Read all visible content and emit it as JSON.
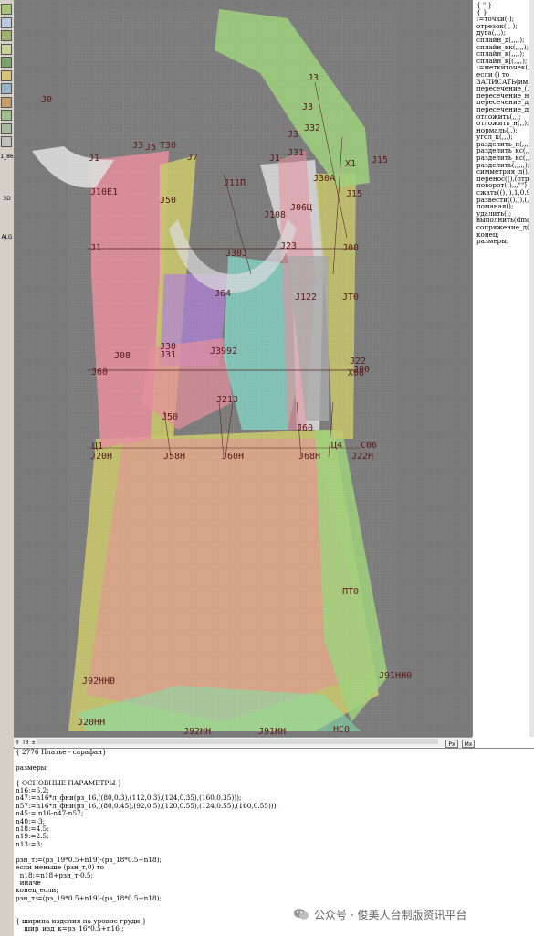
{
  "toolbar": {
    "tools": [
      {
        "icon": "pencil-icon",
        "color": "#a7c47a"
      },
      {
        "icon": "curve-icon",
        "color": "#b9c9e0"
      },
      {
        "icon": "grid-icon",
        "color": "#9fb26a"
      },
      {
        "icon": "line-icon",
        "color": "#c8d49a"
      },
      {
        "icon": "scissors-icon",
        "color": "#7aa36c"
      },
      {
        "icon": "measure-icon",
        "color": "#d9c27a"
      },
      {
        "icon": "mirror-icon",
        "color": "#9ab3c9"
      },
      {
        "icon": "magnet-icon",
        "color": "#c79b6b"
      },
      {
        "icon": "dart-icon",
        "color": "#9fbf8f"
      },
      {
        "icon": "rotate-icon",
        "color": "#a9b9a0"
      },
      {
        "icon": "text-g-icon",
        "color": "#c0c0c0"
      }
    ],
    "labels": {
      "l1": "1_86",
      "l2": "3D",
      "l3": "ALG"
    }
  },
  "canvas": {
    "background": "#7a7a7a",
    "grid": true,
    "point_labels": [
      {
        "text": "J0",
        "id": "j0"
      },
      {
        "text": "J3",
        "id": "j3"
      },
      {
        "text": "J10E1",
        "id": "j10e1"
      },
      {
        "text": "J5",
        "id": "j5"
      },
      {
        "text": "T30",
        "id": "t30"
      },
      {
        "text": "J7",
        "id": "j7"
      },
      {
        "text": "J11Π",
        "id": "j11p"
      },
      {
        "text": "J108",
        "id": "j108"
      },
      {
        "text": "J06Ц",
        "id": "j06c"
      },
      {
        "text": "J23",
        "id": "j23"
      },
      {
        "text": "J30J",
        "id": "j30j"
      },
      {
        "text": "J64",
        "id": "j64"
      },
      {
        "text": "J122",
        "id": "j122"
      },
      {
        "text": "JT0",
        "id": "jt0"
      },
      {
        "text": "J1",
        "id": "j1"
      },
      {
        "text": "J1",
        "id": "j1b"
      },
      {
        "text": "J1",
        "id": "j1c"
      },
      {
        "text": "J15",
        "id": "j15"
      },
      {
        "text": "J15",
        "id": "j15b"
      },
      {
        "text": "J3",
        "id": "j3b"
      },
      {
        "text": "J3",
        "id": "j3c"
      },
      {
        "text": "X1",
        "id": "x1"
      },
      {
        "text": "J30A",
        "id": "j30a"
      },
      {
        "text": "J00",
        "id": "j00"
      },
      {
        "text": "J31",
        "id": "j31"
      },
      {
        "text": "J50",
        "id": "j50"
      },
      {
        "text": "J3992",
        "id": "j3992"
      },
      {
        "text": "J30",
        "id": "j30"
      },
      {
        "text": "J08",
        "id": "j08"
      },
      {
        "text": "J60",
        "id": "j60"
      },
      {
        "text": "J00",
        "id": "j00b"
      },
      {
        "text": "J22",
        "id": "j22"
      },
      {
        "text": "X00",
        "id": "x00"
      },
      {
        "text": "J213",
        "id": "j213"
      },
      {
        "text": "J50",
        "id": "j50b"
      },
      {
        "text": "J60",
        "id": "j60b"
      },
      {
        "text": "Ц1",
        "id": "c1"
      },
      {
        "text": "J20H",
        "id": "j20h"
      },
      {
        "text": "J58H",
        "id": "j58h"
      },
      {
        "text": "J60H",
        "id": "j60h"
      },
      {
        "text": "J68H",
        "id": "j68h"
      },
      {
        "text": "Ц4",
        "id": "c4"
      },
      {
        "text": "C06",
        "id": "c06"
      },
      {
        "text": "J22H",
        "id": "j22h"
      },
      {
        "text": "ΠT0",
        "id": "pt0"
      },
      {
        "text": "J92HH0",
        "id": "j92hh0"
      },
      {
        "text": "J91HH0",
        "id": "j91hh0"
      },
      {
        "text": "J20HH",
        "id": "j20hh"
      },
      {
        "text": "J92HH",
        "id": "j92hh"
      },
      {
        "text": "J91HH",
        "id": "j91hh"
      },
      {
        "text": "HC0",
        "id": "hc0"
      },
      {
        "text": "J32",
        "id": "j32"
      },
      {
        "text": "J31",
        "id": "j31b"
      },
      {
        "text": "J3",
        "id": "j3d"
      }
    ],
    "colors": {
      "pink": "#e58d9b",
      "olive": "#c7c46a",
      "green": "#9ed07a",
      "cyan": "#84d8c8",
      "purple": "#b07fd8",
      "white": "#dcdcdc",
      "orange": "#e0a860",
      "mint": "#7fe0a8",
      "line": "#5a2a2a"
    }
  },
  "commands": {
    "items": [
      "{ \" }",
      "{ }",
      ":=точки(,);",
      "отрезок( , );",
      "дуга(,,,);",
      "сплайн_д(,,,,);",
      "сплайн_кк(,,,,);",
      "сплайн_к(,,,,);",
      "сплайн_к[(,,,,);",
      ":=меткиточек(,);",
      "если () то",
      "ЗАПИСАТЬ(имя",
      "пересечение_(,);",
      "пересечение_н(,",
      "пересечение_д(,",
      "пересечение_дн(",
      "отложить(,,);",
      "отложить_н(,,);",
      "нормаль(,,);",
      "угол_к(,,,);",
      "разделить_н(,,,,,",
      "разделить_кс(,,,,",
      "разделить_кс(,,,",
      "разделить(,,,,,);",
      "симметрия_л(),(",
      "перенос((),(отрез",
      "поворот((),,,\"\")",
      "сжать((),,),1,0.9,",
      "развести((),(),(,",
      "ломаная();",
      "удалить();",
      "выполнить(dmod",
      "сопряжение_д(,,",
      "конец;",
      "размеры;"
    ]
  },
  "status": {
    "coords": "0  T0 ± 0.0",
    "btn1": "Px",
    "btn2": "Mx"
  },
  "editor": {
    "lines": [
      "{ 2776 Платье - сарафан}",
      "",
      "размеры;",
      "",
      "{ ОСНОВНЫЕ ПАРАМЕТРЫ }",
      "n16:=6.2;",
      "n47:=n16*л_фни(рз_16,((80,0.3),(112,0.3),(124,0.35),(160,0.35)));",
      "n57:=n16*л_фни(рз_16,((80,0.45),(92,0.5),(120,0.55),(124,0.55),(160,0.55)));",
      "n45:= n16-n47-n57;",
      "n40:=-3;",
      "n18:=4.5;",
      "n19:=2.5;",
      "n13:=3;",
      "",
      "рзн_т:=(рз_19*0.5+n19)-(рз_18*0.5+n18);",
      "если меньше (рзн_т,0) то",
      "  n18:=n18+рзн_т-0.5;",
      "  иначе",
      "конец_если;",
      "рзн_т:=(рз_19*0.5+n19)-(рз_18*0.5+n18);",
      "",
      "",
      "{ ширина изделия на уровне груди }",
      "    шир_изд_к=рз_16*0.5+n16 ;"
    ]
  },
  "watermark": {
    "text": "公众号 · 俊美人台制版资讯平台"
  }
}
